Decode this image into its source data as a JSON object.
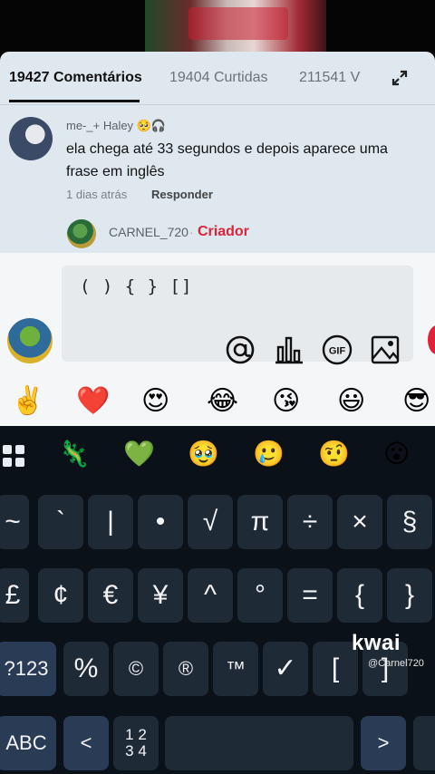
{
  "tabs": {
    "comments": "19427 Comentários",
    "likes": "19404 Curtidas",
    "views": "211541 V"
  },
  "comment": {
    "user": "me-_+ Haley 🥺🎧",
    "text": "ela chega até 33 segundos e depois aparece uma frase em inglês",
    "time": "1 dias atrás",
    "reply": "Responder"
  },
  "sub_comment": {
    "user": "CARNEL_720",
    "separator": "·",
    "badge": "Criador"
  },
  "input": {
    "value": "( ) { } []"
  },
  "tools": [
    "at-icon",
    "chart-icon",
    "gif-icon",
    "image-icon"
  ],
  "tool_gif_label": "GIF",
  "reactions": [
    "✌️",
    "❤️",
    "😍",
    "😂",
    "😘",
    "😃",
    "😎"
  ],
  "emoji_bar": [
    "🦎",
    "💚",
    "🥹",
    "🥲",
    "🤨",
    "😮"
  ],
  "keys": {
    "row1": [
      "~",
      "`",
      "|",
      "•",
      "√",
      "π",
      "÷",
      "×",
      "§"
    ],
    "row2": [
      "£",
      "¢",
      "€",
      "¥",
      "^",
      "°",
      "=",
      "{",
      "}"
    ],
    "row3": [
      "?123",
      "%",
      "©",
      "®",
      "™",
      "✓",
      "[",
      "]"
    ],
    "row4_abc": "ABC",
    "row4_left": "<",
    "row4_page": "1 2\n3 4",
    "row4_right": ">"
  },
  "watermark": {
    "logo": "kwai",
    "handle": "@Carnel720"
  },
  "colors": {
    "accent_red": "#e0213a",
    "panel_bg": "#dfe8ee",
    "keyboard_bg": "#0b1118"
  }
}
